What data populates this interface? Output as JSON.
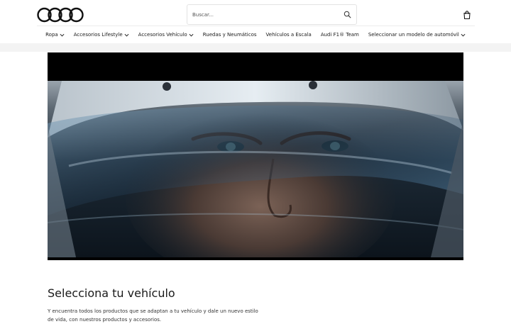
{
  "header": {
    "search": {
      "placeholder": "Buscar..."
    }
  },
  "nav": {
    "items": [
      {
        "label": "Ropa",
        "has_dropdown": true
      },
      {
        "label": "Accesorios Lifestyle",
        "has_dropdown": true
      },
      {
        "label": "Accesorios Vehículo",
        "has_dropdown": true
      },
      {
        "label": "Ruedas y Neumáticos",
        "has_dropdown": false
      },
      {
        "label": "Vehículos a Escala",
        "has_dropdown": false
      },
      {
        "label": "Audi F1® Team",
        "has_dropdown": false
      },
      {
        "label": "Seleccionar un modelo de automóvil",
        "has_dropdown": true
      }
    ]
  },
  "main": {
    "title": "Selecciona tu vehículo",
    "description": "Y encuentra todos los productos que se adaptan a tu vehículo y dale un nuevo estilo de vida, con nuestros productos y accesorios."
  },
  "icons": {
    "logo": "audi-rings-logo",
    "search": "search-icon",
    "cart": "shopping-bag-icon",
    "chevron": "chevron-down-icon"
  },
  "colors": {
    "text": "#1a1a1a",
    "band": "#f3f3f3",
    "hero_bg": "#000000"
  }
}
